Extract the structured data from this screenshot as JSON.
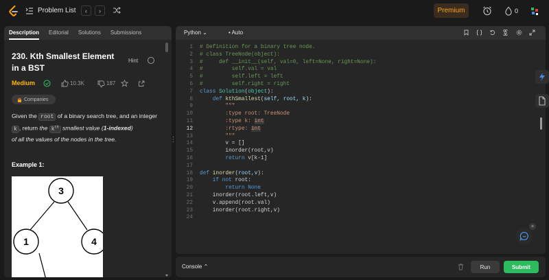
{
  "topbar": {
    "problem_list": "Problem List",
    "premium": "Premium",
    "streak_count": "0",
    "prev_symbol": "‹",
    "next_symbol": "›"
  },
  "left": {
    "tabs": [
      {
        "label": "Description",
        "active": true
      },
      {
        "label": "Editorial",
        "active": false
      },
      {
        "label": "Solutions",
        "active": false
      },
      {
        "label": "Submissions",
        "active": false
      }
    ],
    "title": "230. Kth Smallest Element in a BST",
    "hint": "Hint",
    "difficulty": "Medium",
    "likes": "10.3K",
    "dislikes": "187",
    "companies": "Companies",
    "desc": {
      "p1": "Given the ",
      "root": "root",
      "p2": " of a binary search tree, and an integer ",
      "k": "k",
      "p3": ", return ",
      "the": "the ",
      "kth_k": "k",
      "kth_sup": "th",
      "p4": " smallest value (",
      "one_indexed": "1-indexed",
      "p5": ")",
      "p6": "of all the values of the nodes in the tree."
    },
    "example": "Example 1:",
    "tree": {
      "root": "3",
      "left": "1",
      "right": "4"
    }
  },
  "editor": {
    "language": "Python",
    "mode": "Auto",
    "current_line": 12
  },
  "console": {
    "label": "Console",
    "run": "Run",
    "submit": "Submit"
  },
  "colors": {
    "accent_green": "#2cbb5d",
    "premium_orange": "#ffa116",
    "medium_yellow": "#ffb800"
  }
}
